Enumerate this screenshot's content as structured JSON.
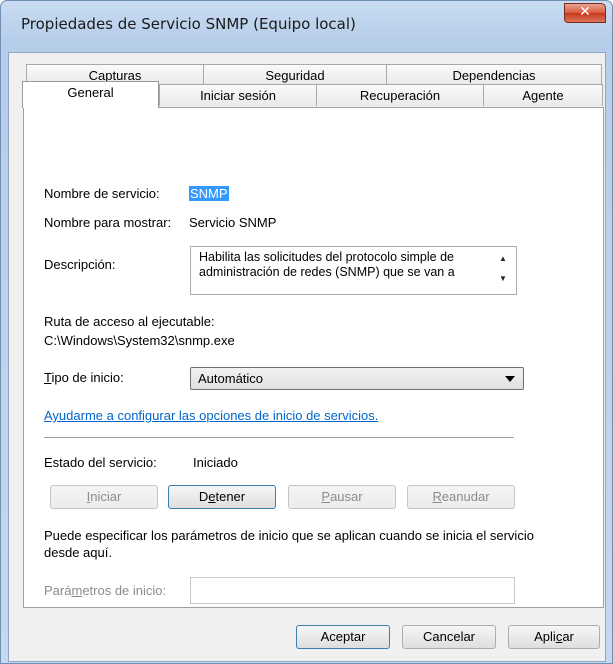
{
  "window": {
    "title": "Propiedades de Servicio SNMP (Equipo local)",
    "close_glyph": "✕"
  },
  "tabs": {
    "row1": [
      "Capturas",
      "Seguridad",
      "Dependencias"
    ],
    "row2": [
      "General",
      "Iniciar sesión",
      "Recuperación",
      "Agente"
    ],
    "active": "General"
  },
  "general": {
    "service_name_label": "Nombre de servicio:",
    "service_name": "SNMP",
    "display_name_label": "Nombre para mostrar:",
    "display_name": "Servicio SNMP",
    "description_label": "Descripción:",
    "description": "Habilita las solicitudes del protocolo simple de administración de redes (SNMP) que se van a",
    "exe_path_label": "Ruta de acceso al ejecutable:",
    "exe_path": "C:\\Windows\\System32\\snmp.exe",
    "startup_type_label_first": "T",
    "startup_type_label_rest": "ipo de inicio:",
    "startup_type": "Automático",
    "help_link": "Ayudarme a configurar las opciones de inicio de servicios.",
    "status_label": "Estado del servicio:",
    "status": "Iniciado",
    "buttons": {
      "start": {
        "before": "",
        "mnemonic": "I",
        "after": "niciar"
      },
      "stop": {
        "before": "D",
        "mnemonic": "e",
        "after": "tener"
      },
      "pause": {
        "before": "",
        "mnemonic": "P",
        "after": "ausar"
      },
      "resume": {
        "before": "",
        "mnemonic": "R",
        "after": "eanudar"
      }
    },
    "hint": "Puede especificar los parámetros de inicio que se aplican cuando se inicia el servicio desde aquí.",
    "params_label_before": "Pará",
    "params_label_mnemonic": "m",
    "params_label_after": "etros de inicio:",
    "params_value": ""
  },
  "footer": {
    "ok": "Aceptar",
    "cancel": "Cancelar",
    "apply_before": "Apli",
    "apply_mnemonic": "c",
    "apply_after": "ar"
  }
}
